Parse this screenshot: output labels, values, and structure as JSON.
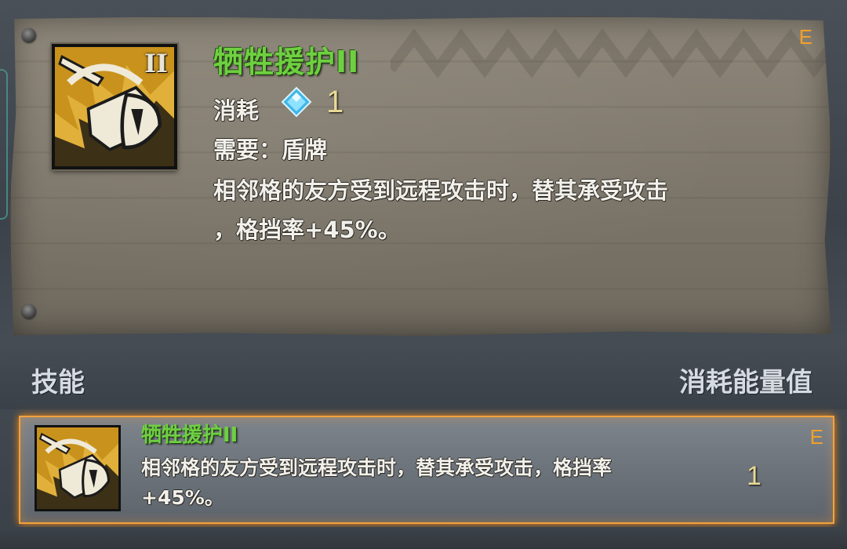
{
  "tooltip": {
    "skill_name": "牺牲援护II",
    "rank_numeral": "II",
    "grade": "E",
    "cost_label": "消耗",
    "cost_icon": "energy-crystal-icon",
    "cost_value": "1",
    "requirement": "需要：盾牌",
    "description_line1": "相邻格的友方受到远程攻击时，替其承受攻击",
    "description_line2": "，格挡率+45%。"
  },
  "list_header": {
    "skill_column": "技能",
    "cost_column": "消耗能量值"
  },
  "skill_list": [
    {
      "name": "牺牲援护II",
      "description_line1": "相邻格的友方受到远程攻击时，替其承受攻击，格挡率",
      "description_line2": "+45%。",
      "cost": "1",
      "grade": "E",
      "icon": "shield-skill-icon",
      "selected": true
    }
  ],
  "colors": {
    "skill_name_green": "#6ed040",
    "grade_orange": "#f0a02a",
    "selection_border": "#f4a23a",
    "cost_gold": "#e6d996"
  }
}
